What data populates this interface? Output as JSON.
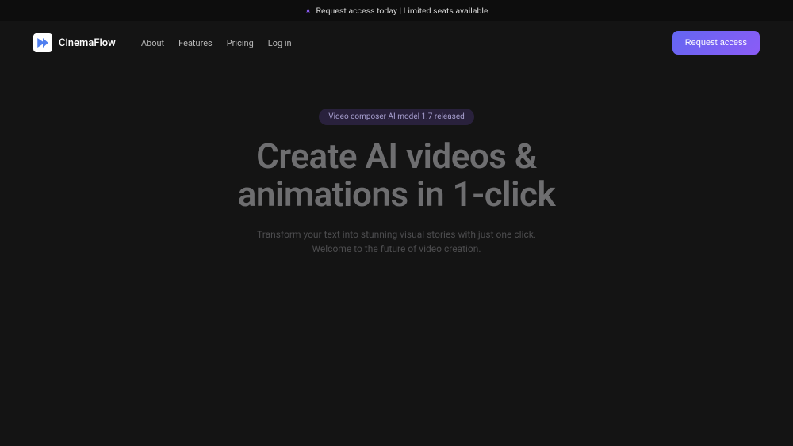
{
  "announcement": {
    "text": "Request access today | Limited seats available"
  },
  "brand": {
    "name": "CinemaFlow"
  },
  "nav": {
    "items": [
      "About",
      "Features",
      "Pricing",
      "Log in"
    ]
  },
  "cta": {
    "label": "Request access"
  },
  "hero": {
    "badge": "Video composer AI model 1.7 released",
    "heading_line1": "Create AI videos &",
    "heading_line2": "animations in 1-click",
    "subtext_line1": "Transform your text into stunning visual stories with just one click.",
    "subtext_line2": "Welcome to the future of video creation."
  }
}
